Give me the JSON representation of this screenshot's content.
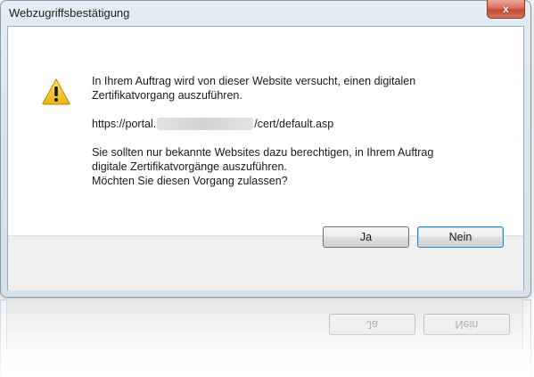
{
  "window": {
    "title": "Webzugriffsbestätigung",
    "close_glyph": "x"
  },
  "message": {
    "line1": "In Ihrem Auftrag wird von dieser Website versucht, einen digitalen",
    "line2": "Zertifikatvorgang auszuführen.",
    "url_prefix": "https://portal.",
    "url_suffix": "/cert/default.asp",
    "line3": "Sie sollten nur bekannte Websites dazu berechtigen, in Ihrem Auftrag",
    "line4": "digitale Zertifikatvorgänge auszuführen.",
    "line5": "Möchten Sie diesen Vorgang zulassen?"
  },
  "buttons": {
    "yes_label": "Ja",
    "no_label": "Nein"
  },
  "icon": {
    "name": "warning-icon",
    "color": "#f2c414"
  }
}
